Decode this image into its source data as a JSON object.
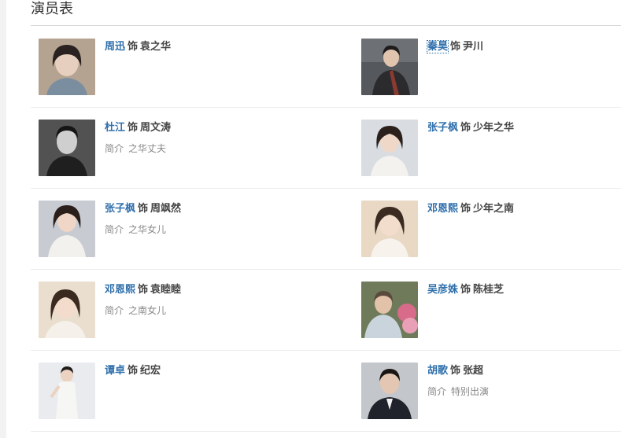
{
  "section": {
    "title": "演员表"
  },
  "cast": [
    {
      "actor": "周迅",
      "shi": "饰",
      "role": "袁之华",
      "intro_label": "",
      "intro": ""
    },
    {
      "actor": "秦昊",
      "shi": "饰",
      "role": "尹川",
      "intro_label": "",
      "intro": ""
    },
    {
      "actor": "杜江",
      "shi": "饰",
      "role": "周文涛",
      "intro_label": "简介",
      "intro": "之华丈夫"
    },
    {
      "actor": "张子枫",
      "shi": "饰",
      "role": "少年之华",
      "intro_label": "",
      "intro": ""
    },
    {
      "actor": "张子枫",
      "shi": "饰",
      "role": "周飒然",
      "intro_label": "简介",
      "intro": "之华女儿"
    },
    {
      "actor": "邓恩熙",
      "shi": "饰",
      "role": "少年之南",
      "intro_label": "",
      "intro": ""
    },
    {
      "actor": "邓恩熙",
      "shi": "饰",
      "role": "袁睦睦",
      "intro_label": "简介",
      "intro": "之南女儿"
    },
    {
      "actor": "吴彦姝",
      "shi": "饰",
      "role": "陈桂芝",
      "intro_label": "",
      "intro": ""
    },
    {
      "actor": "谭卓",
      "shi": "饰",
      "role": "纪宏",
      "intro_label": "",
      "intro": ""
    },
    {
      "actor": "胡歌",
      "shi": "饰",
      "role": "张超",
      "intro_label": "简介",
      "intro": "特别出演"
    }
  ],
  "colors": {
    "actor_link": "#2f6fab",
    "text": "#444444",
    "muted": "#888888",
    "rule": "#ececec"
  }
}
